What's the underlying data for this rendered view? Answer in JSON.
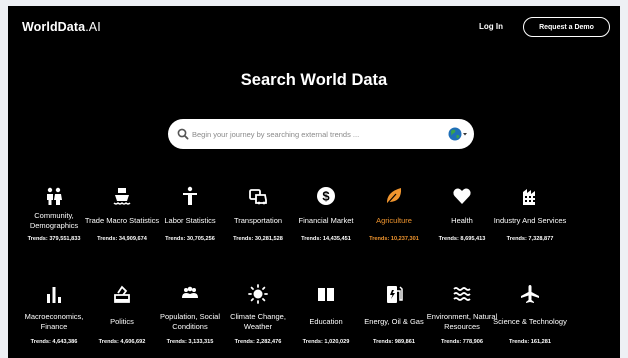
{
  "header": {
    "logo_bold": "WorldData",
    "logo_rest": ".AI",
    "login_label": "Log In",
    "demo_label": "Request a Demo"
  },
  "hero": {
    "title": "Search World Data"
  },
  "search": {
    "placeholder": "Begin your journey by searching external trends ..."
  },
  "accent_color": "#f0952e",
  "categories": [
    {
      "label": "Community, Demographics",
      "trend": "Trends: 379,551,833",
      "icon": "people-icon"
    },
    {
      "label": "Trade Macro Statistics",
      "trend": "Trends: 34,909,674",
      "icon": "ship-icon"
    },
    {
      "label": "Labor Statistics",
      "trend": "Trends: 30,705,256",
      "icon": "worker-icon"
    },
    {
      "label": "Transportation",
      "trend": "Trends: 30,281,528",
      "icon": "car-icon"
    },
    {
      "label": "Financial Market",
      "trend": "Trends: 14,435,451",
      "icon": "dollar-icon"
    },
    {
      "label": "Agriculture",
      "trend": "Trends: 10,237,301",
      "icon": "leaf-icon"
    },
    {
      "label": "Health",
      "trend": "Trends: 8,695,413",
      "icon": "heart-icon"
    },
    {
      "label": "Industry And Services",
      "trend": "Trends: 7,328,877",
      "icon": "factory-icon"
    },
    {
      "label": "Macroeconomics, Finance",
      "trend": "Trends: 4,643,386",
      "icon": "bar-chart-icon"
    },
    {
      "label": "Politics",
      "trend": "Trends: 4,606,692",
      "icon": "ballot-icon"
    },
    {
      "label": "Population, Social Conditions",
      "trend": "Trends: 3,133,315",
      "icon": "group-icon"
    },
    {
      "label": "Climate Change, Weather",
      "trend": "Trends: 2,282,476",
      "icon": "sun-icon"
    },
    {
      "label": "Education",
      "trend": "Trends: 1,020,029",
      "icon": "book-icon"
    },
    {
      "label": "Energy, Oil & Gas",
      "trend": "Trends: 989,861",
      "icon": "fuel-icon"
    },
    {
      "label": "Environment, Natural Resources",
      "trend": "Trends: 778,906",
      "icon": "waves-icon"
    },
    {
      "label": "Science & Technology",
      "trend": "Trends: 161,281",
      "icon": "airplane-icon"
    }
  ]
}
